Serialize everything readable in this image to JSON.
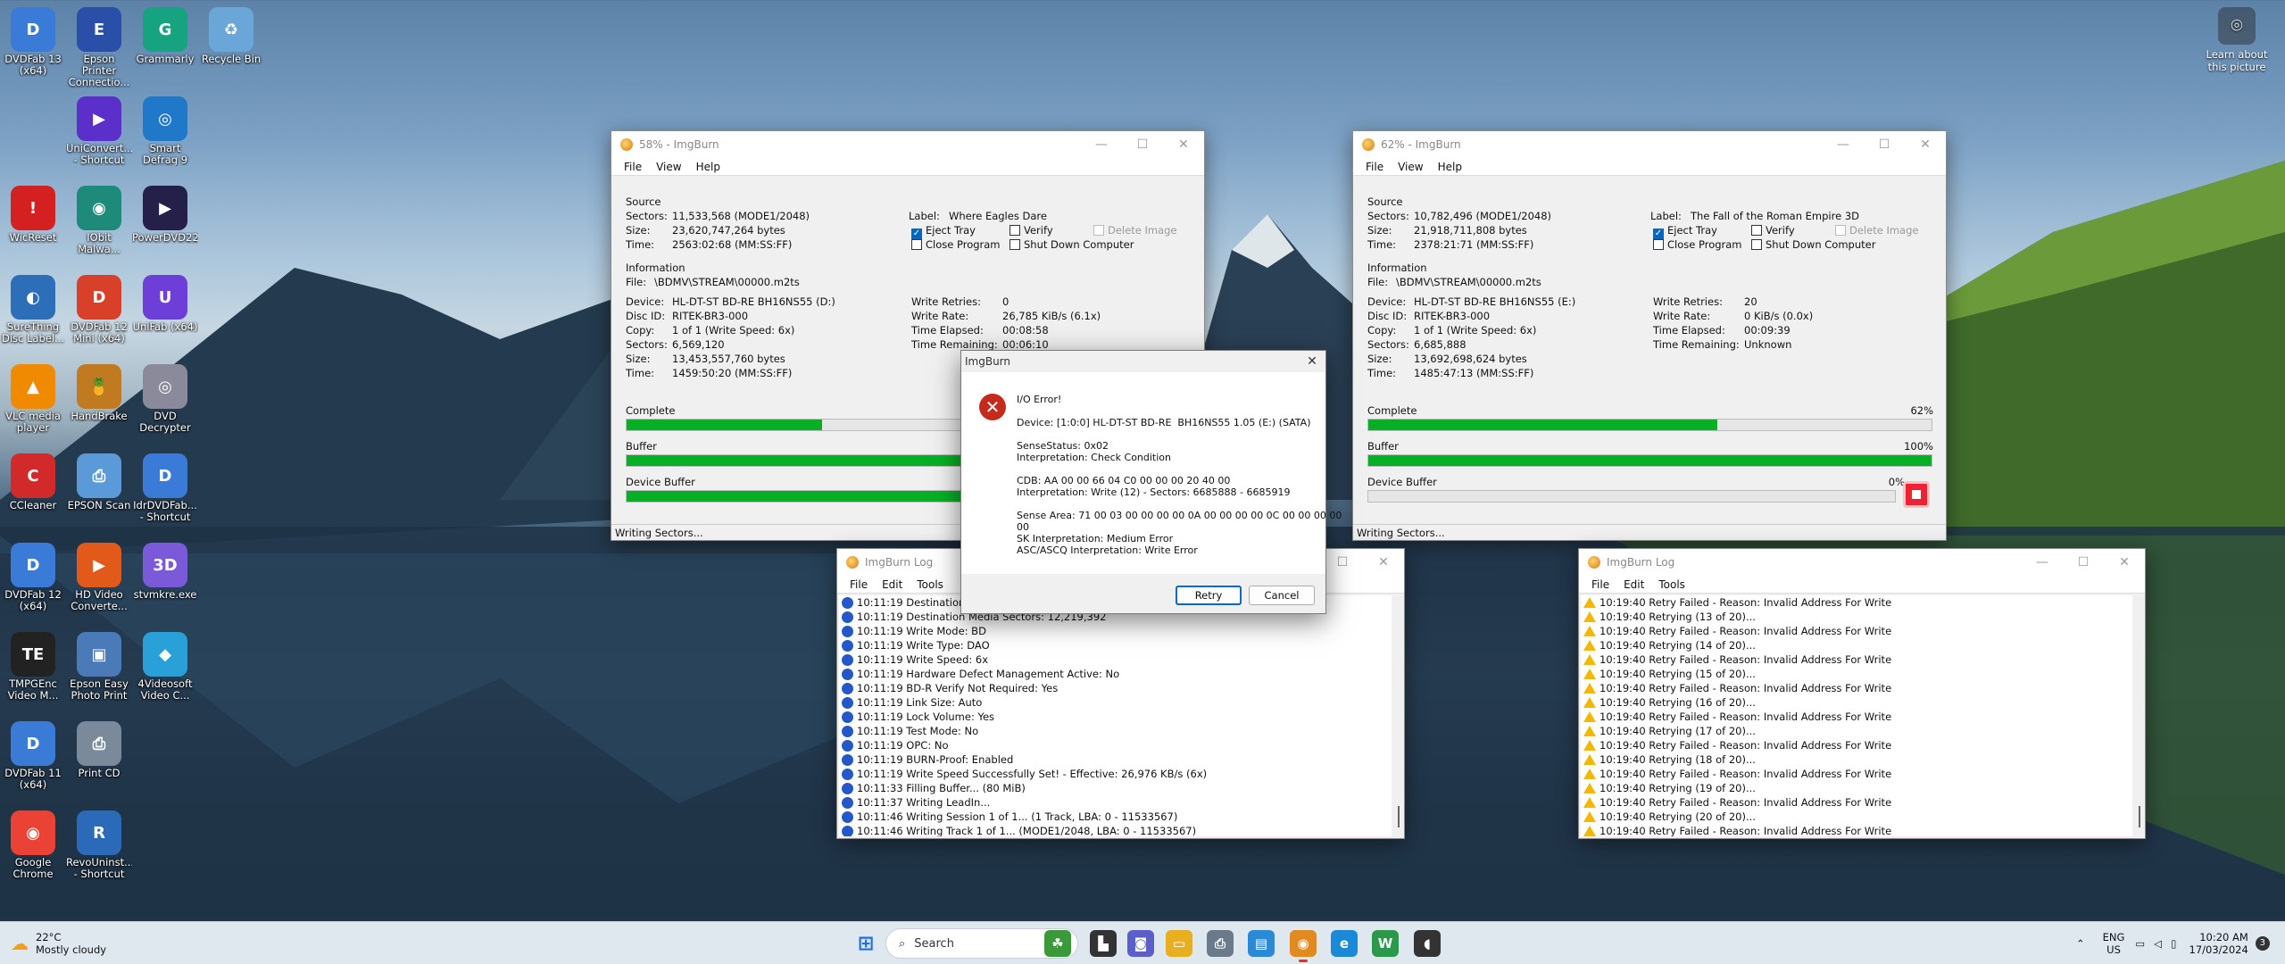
{
  "desktop": {
    "icons": [
      {
        "label": "DVDFab 13 (x64)",
        "icon": "dvdfab-icon",
        "color": "#3b7bd8",
        "glyph": "D"
      },
      {
        "label": "Epson Printer Connectio...",
        "icon": "epson-printer-icon",
        "color": "#2a4fa8",
        "glyph": "E"
      },
      {
        "label": "Grammarly",
        "icon": "grammarly-icon",
        "color": "#16a37f",
        "glyph": "G"
      },
      {
        "label": "Recycle Bin",
        "icon": "recycle-bin-icon",
        "color": "#6aa6d8",
        "glyph": "♻"
      },
      {
        "label": "UniConvert... - Shortcut",
        "icon": "uniconverter-icon",
        "color": "#5b2fc9",
        "glyph": "▶"
      },
      {
        "label": "Smart Defrag 9",
        "icon": "smart-defrag-icon",
        "color": "#1f78c8",
        "glyph": "◎"
      },
      {
        "label": "WicReset",
        "icon": "wicreset-icon",
        "color": "#d42020",
        "glyph": "!"
      },
      {
        "label": "IObit Malwa...",
        "icon": "iobit-malware-icon",
        "color": "#1e8a7a",
        "glyph": "◉"
      },
      {
        "label": "PowerDVD22",
        "icon": "powerdvd-icon",
        "color": "#25204a",
        "glyph": "▶"
      },
      {
        "label": "SureThing Disc Label...",
        "icon": "surething-icon",
        "color": "#2c6fb8",
        "glyph": "◐"
      },
      {
        "label": "DVDFab 12 Mini (x64)",
        "icon": "dvdfab-mini-icon",
        "color": "#d8402a",
        "glyph": "D"
      },
      {
        "label": "UniFab (x64)",
        "icon": "unifab-icon",
        "color": "#6d3fd8",
        "glyph": "U"
      },
      {
        "label": "VLC media player",
        "icon": "vlc-icon",
        "color": "#f08a00",
        "glyph": "▲"
      },
      {
        "label": "HandBrake",
        "icon": "handbrake-icon",
        "color": "#c07a20",
        "glyph": "🍍"
      },
      {
        "label": "DVD Decrypter",
        "icon": "dvd-decrypter-icon",
        "color": "#8a8a9a",
        "glyph": "◎"
      },
      {
        "label": "CCleaner",
        "icon": "ccleaner-icon",
        "color": "#d22a2a",
        "glyph": "C"
      },
      {
        "label": "EPSON Scan",
        "icon": "epson-scan-icon",
        "color": "#5a9ad8",
        "glyph": "⎙"
      },
      {
        "label": "IdrDVDFab... - Shortcut",
        "icon": "dvdfab-shortcut-icon",
        "color": "#3b7bd8",
        "glyph": "D"
      },
      {
        "label": "DVDFab 12 (x64)",
        "icon": "dvdfab12-icon",
        "color": "#3b7bd8",
        "glyph": "D"
      },
      {
        "label": "HD Video Converte...",
        "icon": "hd-video-converter-icon",
        "color": "#e25a1a",
        "glyph": "▶"
      },
      {
        "label": "stvmkre.exe",
        "icon": "stvmkre-icon",
        "color": "#7a5ad8",
        "glyph": "3D"
      },
      {
        "label": "TMPGEnc Video M...",
        "icon": "tmpgenc-icon",
        "color": "#222222",
        "glyph": "TE"
      },
      {
        "label": "Epson Easy Photo Print",
        "icon": "epson-photo-icon",
        "color": "#4a7ab8",
        "glyph": "▣"
      },
      {
        "label": "4Videosoft Video C...",
        "icon": "4videosoft-icon",
        "color": "#2aa0d8",
        "glyph": "◆"
      },
      {
        "label": "DVDFab 11 (x64)",
        "icon": "dvdfab11-icon",
        "color": "#3b7bd8",
        "glyph": "D"
      },
      {
        "label": "Print CD",
        "icon": "print-cd-icon",
        "color": "#7a8a9a",
        "glyph": "⎙"
      },
      {
        "label": "Google Chrome",
        "icon": "chrome-icon",
        "color": "#ea4335",
        "glyph": "◉"
      },
      {
        "label": "RevoUninst... - Shortcut",
        "icon": "revo-uninstaller-icon",
        "color": "#2a6ab8",
        "glyph": "R"
      }
    ],
    "learn_label": "Learn about this picture"
  },
  "window1": {
    "title": "58% - ImgBurn",
    "menu": [
      "File",
      "View",
      "Help"
    ],
    "source_label": "Source",
    "sectors": "11,533,568 (MODE1/2048)",
    "size": "23,620,747,264 bytes",
    "time": "2563:02:68 (MM:SS:FF)",
    "label_label": "Label:",
    "label_value": "Where Eagles Dare",
    "eject_tray": "Eject Tray",
    "verify": "Verify",
    "delete_image": "Delete Image",
    "close_program": "Close Program",
    "shut_down": "Shut Down Computer",
    "info_label": "Information",
    "file": "\\BDMV\\STREAM\\00000.m2ts",
    "device": "HL-DT-ST BD-RE BH16NS55 (D:)",
    "disc_id": "RITEK-BR3-000",
    "copy": "1 of 1 (Write Speed: 6x)",
    "info_sectors": "6,569,120",
    "info_size": "13,453,557,760 bytes",
    "info_time": "1459:50:20 (MM:SS:FF)",
    "write_retries": "0",
    "write_rate": "26,785 KiB/s (6.1x)",
    "time_elapsed": "00:08:58",
    "time_remaining": "00:06:10",
    "complete_label": "Complete",
    "complete_pct": 58,
    "buffer_label": "Buffer",
    "buffer_pct": 100,
    "device_buffer_label": "Device Buffer",
    "device_buffer_pct": 100,
    "status": "Writing Sectors..."
  },
  "window2": {
    "title": "62% - ImgBurn",
    "menu": [
      "File",
      "View",
      "Help"
    ],
    "source_label": "Source",
    "sectors": "10,782,496 (MODE1/2048)",
    "size": "21,918,711,808 bytes",
    "time": "2378:21:71 (MM:SS:FF)",
    "label_label": "Label:",
    "label_value": "The Fall of the Roman Empire 3D",
    "eject_tray": "Eject Tray",
    "verify": "Verify",
    "delete_image": "Delete Image",
    "close_program": "Close Program",
    "shut_down": "Shut Down Computer",
    "info_label": "Information",
    "file": "\\BDMV\\STREAM\\00000.m2ts",
    "device": "HL-DT-ST BD-RE BH16NS55 (E:)",
    "disc_id": "RITEK-BR3-000",
    "copy": "1 of 1 (Write Speed: 6x)",
    "info_sectors": "6,685,888",
    "info_size": "13,692,698,624 bytes",
    "info_time": "1485:47:13 (MM:SS:FF)",
    "write_retries": "20",
    "write_rate": "0 KiB/s (0.0x)",
    "time_elapsed": "00:09:39",
    "time_remaining": "Unknown",
    "complete_label": "Complete",
    "complete_pct": 62,
    "complete_pct_text": "62%",
    "buffer_label": "Buffer",
    "buffer_pct": 100,
    "buffer_pct_text": "100%",
    "device_buffer_label": "Device Buffer",
    "device_buffer_pct": 0,
    "device_buffer_pct_text": "0%",
    "status": "Writing Sectors..."
  },
  "field_labels": {
    "sectors": "Sectors:",
    "size": "Size:",
    "time": "Time:",
    "file": "File:",
    "device": "Device:",
    "disc_id": "Disc ID:",
    "copy": "Copy:",
    "write_retries": "Write Retries:",
    "write_rate": "Write Rate:",
    "time_elapsed": "Time Elapsed:",
    "time_remaining": "Time Remaining:"
  },
  "log1": {
    "title": "ImgBurn Log",
    "menu": [
      "File",
      "Edit",
      "Tools"
    ],
    "lines": [
      "10:11:19 Destination Media Type: BD-R (Disc ID: RITEK-BR3-000)",
      "10:11:19 Destination Media Sectors: 12,219,392",
      "10:11:19 Write Mode: BD",
      "10:11:19 Write Type: DAO",
      "10:11:19 Write Speed: 6x",
      "10:11:19 Hardware Defect Management Active: No",
      "10:11:19 BD-R Verify Not Required: Yes",
      "10:11:19 Link Size: Auto",
      "10:11:19 Lock Volume: Yes",
      "10:11:19 Test Mode: No",
      "10:11:19 OPC: No",
      "10:11:19 BURN-Proof: Enabled",
      "10:11:19 Write Speed Successfully Set! - Effective: 26,976 KB/s (6x)",
      "10:11:33 Filling Buffer... (80 MiB)",
      "10:11:37 Writing LeadIn...",
      "10:11:46 Writing Session 1 of 1... (1 Track, LBA: 0 - 11533567)",
      "10:11:46 Writing Track 1 of 1... (MODE1/2048, LBA: 0 - 11533567)"
    ]
  },
  "log2": {
    "title": "ImgBurn Log",
    "menu": [
      "File",
      "Edit",
      "Tools"
    ],
    "lines": [
      "10:19:40 Retry Failed - Reason: Invalid Address For Write",
      "10:19:40 Retrying (13 of 20)...",
      "10:19:40 Retry Failed - Reason: Invalid Address For Write",
      "10:19:40 Retrying (14 of 20)...",
      "10:19:40 Retry Failed - Reason: Invalid Address For Write",
      "10:19:40 Retrying (15 of 20)...",
      "10:19:40 Retry Failed - Reason: Invalid Address For Write",
      "10:19:40 Retrying (16 of 20)...",
      "10:19:40 Retry Failed - Reason: Invalid Address For Write",
      "10:19:40 Retrying (17 of 20)...",
      "10:19:40 Retry Failed - Reason: Invalid Address For Write",
      "10:19:40 Retrying (18 of 20)...",
      "10:19:40 Retry Failed - Reason: Invalid Address For Write",
      "10:19:40 Retrying (19 of 20)...",
      "10:19:40 Retry Failed - Reason: Invalid Address For Write",
      "10:19:40 Retrying (20 of 20)...",
      "10:19:40 Retry Failed - Reason: Invalid Address For Write"
    ]
  },
  "dialog": {
    "title": "ImgBurn",
    "message": "I/O Error!\n\nDevice: [1:0:0] HL-DT-ST BD-RE  BH16NS55 1.05 (E:) (SATA)\n\nSenseStatus: 0x02\nInterpretation: Check Condition\n\nCDB: AA 00 00 66 04 C0 00 00 00 20 40 00\nInterpretation: Write (12) - Sectors: 6685888 - 6685919\n\nSense Area: 71 00 03 00 00 00 00 0A 00 00 00 00 0C 00 00 00 00\n00\nSK Interpretation: Medium Error\nASC/ASCQ Interpretation: Write Error",
    "retry": "Retry",
    "cancel": "Cancel"
  },
  "taskbar": {
    "search_placeholder": "Search",
    "weather_temp": "22°C",
    "weather_text": "Mostly cloudy",
    "lang1": "ENG",
    "lang2": "US",
    "time": "10:20 AM",
    "date": "17/03/2024",
    "notif_count": "3",
    "apps": [
      {
        "name": "start-icon",
        "color": "#1f6feb",
        "glyph": "⊞"
      },
      {
        "name": "widget-icon",
        "color": "#3a9a3a",
        "glyph": "☘"
      },
      {
        "name": "terminal-icon",
        "color": "#333333",
        "glyph": "▙"
      },
      {
        "name": "teams-icon",
        "color": "#5b5fc7",
        "glyph": "◙"
      },
      {
        "name": "file-explorer-icon",
        "color": "#e8b020",
        "glyph": "▭"
      },
      {
        "name": "printer-icon",
        "color": "#6a7a8a",
        "glyph": "⎙"
      },
      {
        "name": "photos-icon",
        "color": "#2a8ad8",
        "glyph": "▤"
      },
      {
        "name": "imgburn-icon",
        "color": "#e08a20",
        "glyph": "◉"
      },
      {
        "name": "edge-icon",
        "color": "#1a8ad8",
        "glyph": "e"
      },
      {
        "name": "uniconverter-taskbar-icon",
        "color": "#2a9a4a",
        "glyph": "W"
      },
      {
        "name": "audio-icon",
        "color": "#333333",
        "glyph": "◖"
      }
    ]
  }
}
